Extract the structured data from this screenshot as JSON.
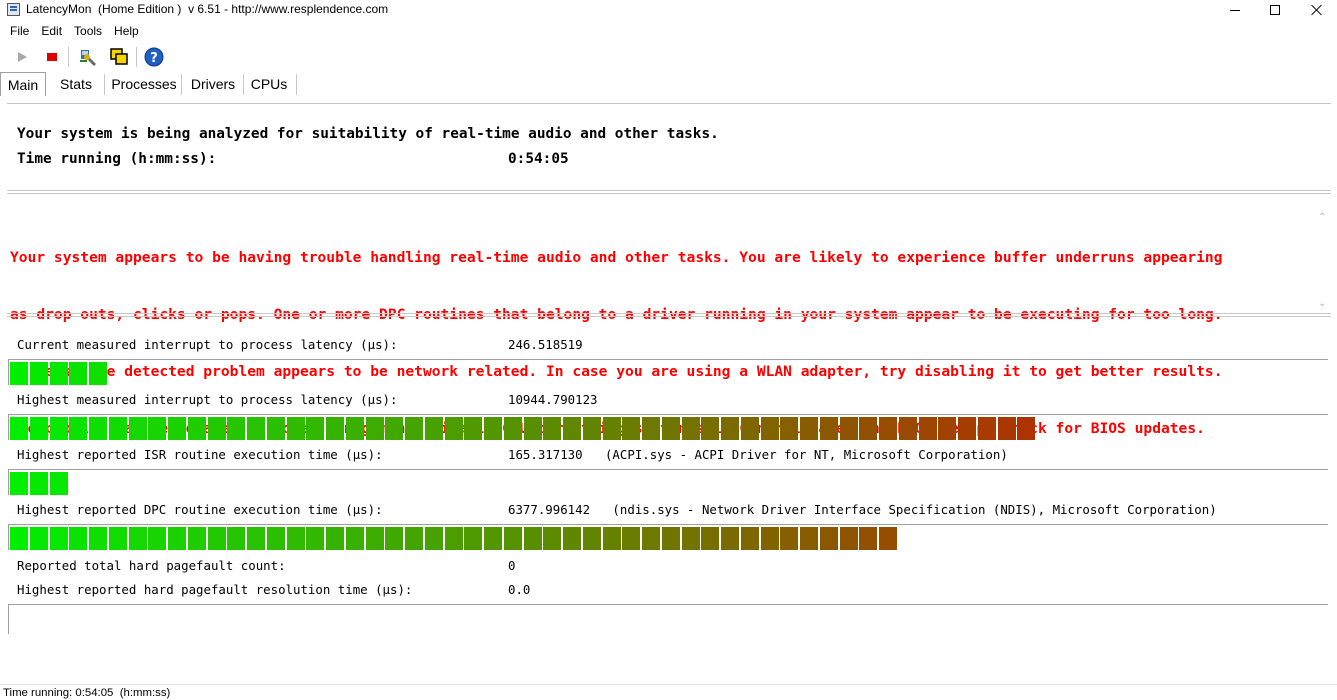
{
  "window": {
    "title": "LatencyMon  (Home Edition )  v 6.51 - http://www.resplendence.com"
  },
  "menu": [
    "File",
    "Edit",
    "Tools",
    "Help"
  ],
  "toolbar": {
    "play_icon": "play-icon",
    "stop_icon": "stop-icon",
    "tool_icon": "wrench-tool-icon",
    "windows_icon": "windows-icon",
    "help_icon": "help-icon"
  },
  "tabs": [
    "Main",
    "Stats",
    "Processes",
    "Drivers",
    "CPUs"
  ],
  "header": {
    "line1": "Your system is being analyzed for suitability of real-time audio and other tasks.",
    "time_label": "Time running (h:mm:ss):",
    "time_value": "0:54:05"
  },
  "warning": {
    "line1": "Your system appears to be having trouble handling real-time audio and other tasks. You are likely to experience buffer underruns appearing",
    "line2": "as drop outs, clicks or pops. One or more DPC routines that belong to a driver running in your system appear to be executing for too long.",
    "line3": "At least one detected problem appears to be network related. In case you are using a WLAN adapter, try disabling it to get better results.",
    "line4": "One problem may be related to power management, disable CPU throttling settings in Control Panel and BIOS setup. Check for BIOS updates."
  },
  "metrics": {
    "current_label": "Current measured interrupt to process latency (µs):",
    "current_value": "246.518519",
    "current_bar_segments": 5,
    "highest_label": "Highest measured interrupt to process latency (µs):",
    "highest_value": "10944.790123",
    "highest_bar_segments": 52,
    "isr_label": "Highest reported ISR routine execution time (µs):",
    "isr_value": "165.317130   (ACPI.sys - ACPI Driver for NT, Microsoft Corporation)",
    "isr_bar_segments": 3,
    "dpc_label": "Highest reported DPC routine execution time (µs):",
    "dpc_value": "6377.996142   (ndis.sys - Network Driver Interface Specification (NDIS), Microsoft Corporation)",
    "dpc_bar_segments": 45,
    "pagefault_count_label": "Reported total hard pagefault count:",
    "pagefault_count_value": "0",
    "pagefault_time_label": "Highest reported hard pagefault resolution time (µs):",
    "pagefault_time_value": "0.0"
  },
  "status": {
    "text": "Time running: 0:54:05  (h:mm:ss)"
  },
  "colors": {
    "warning": "#ff0000",
    "bar_start": "#00ee00",
    "bar_end": "#dd0000"
  }
}
